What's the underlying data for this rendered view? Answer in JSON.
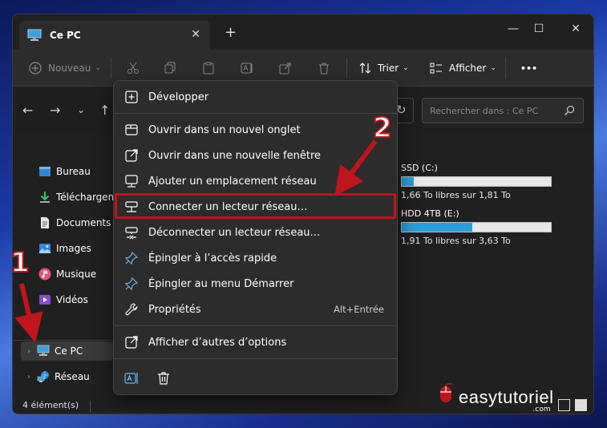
{
  "window": {
    "tab_title": "Ce PC",
    "new_tab": "+",
    "close_tab": "✕",
    "minimize": "—",
    "maximize": "☐",
    "close": "✕"
  },
  "toolbar": {
    "new_label": "Nouveau",
    "sort_label": "Trier",
    "view_label": "Afficher",
    "more_label": "•••"
  },
  "navigation": {
    "search_placeholder": "Rechercher dans : Ce PC"
  },
  "sidebar": {
    "items": [
      {
        "label": "Bureau",
        "icon": "desktop-icon"
      },
      {
        "label": "Téléchargem",
        "icon": "download-icon"
      },
      {
        "label": "Documents",
        "icon": "documents-icon"
      },
      {
        "label": "Images",
        "icon": "images-icon"
      },
      {
        "label": "Musique",
        "icon": "music-icon"
      },
      {
        "label": "Vidéos",
        "icon": "videos-icon"
      }
    ],
    "root_items": [
      {
        "label": "Ce PC",
        "icon": "pc-icon",
        "selected": true
      },
      {
        "label": "Réseau",
        "icon": "network-icon",
        "selected": false
      }
    ]
  },
  "drives": [
    {
      "name": "SSD (C:)",
      "free_text": "1,66 To libres sur 1,81 To",
      "used_fraction": 0.083
    },
    {
      "name": "HDD 4TB (E:)",
      "free_text": "1,91 To libres sur 3,63 To",
      "used_fraction": 0.474
    }
  ],
  "status": {
    "count": "4 élément(s)"
  },
  "context_menu": {
    "items": [
      {
        "label": "Développer",
        "icon": "expand-icon"
      },
      {
        "label": "Ouvrir dans un nouvel onglet",
        "icon": "new-tab-icon"
      },
      {
        "label": "Ouvrir dans une nouvelle fenêtre",
        "icon": "new-window-icon"
      },
      {
        "label": "Ajouter un emplacement réseau",
        "icon": "network-location-icon"
      },
      {
        "label": "Connecter un lecteur réseau…",
        "icon": "map-network-drive-icon"
      },
      {
        "label": "Déconnecter un lecteur réseau…",
        "icon": "disconnect-network-drive-icon"
      },
      {
        "label": "Épingler à l’accès rapide",
        "icon": "pin-icon"
      },
      {
        "label": "Épingler au menu Démarrer",
        "icon": "pin-start-icon"
      },
      {
        "label": "Propriétés",
        "icon": "properties-icon",
        "shortcut": "Alt+Entrée"
      },
      {
        "label": "Afficher d’autres d’options",
        "icon": "more-options-icon"
      }
    ]
  },
  "annotations": {
    "step1": "1",
    "step2": "2",
    "color": "#c0151b"
  },
  "watermark": {
    "text": "easytutoriel",
    "suffix": ".com"
  }
}
